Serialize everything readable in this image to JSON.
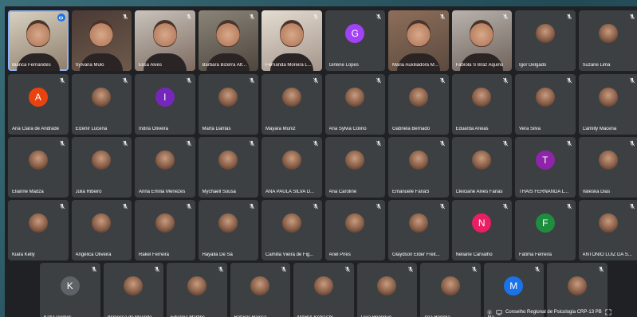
{
  "colors": {
    "stage": "#202124",
    "tile": "#3c4043",
    "speaking": "#1a73e8",
    "highlight": "#8ab4f8"
  },
  "participants": {
    "row1": [
      {
        "name": "Bianca Fernandes",
        "kind": "video",
        "state": "speaking"
      },
      {
        "name": "Sylvana Mulo",
        "kind": "video",
        "state": "muted"
      },
      {
        "name": "Elisa Alves",
        "kind": "video",
        "state": "muted"
      },
      {
        "name": "Bárbara Bizerra Alt...",
        "kind": "video",
        "state": "muted"
      },
      {
        "name": "Fernanda Moreira L...",
        "kind": "video",
        "state": "muted"
      },
      {
        "name": "Girlene Lopes",
        "kind": "letter",
        "letter": "G",
        "color": "#a142f4",
        "state": "muted"
      },
      {
        "name": "Maria Auxiliadora M...",
        "kind": "video",
        "state": "muted"
      },
      {
        "name": "Fabíola S Braz Aquino",
        "kind": "video",
        "state": "muted"
      },
      {
        "name": "Igor Delgado",
        "kind": "photo",
        "state": "muted"
      },
      {
        "name": "Suzane Lima",
        "kind": "photo",
        "state": "muted"
      }
    ],
    "row2": [
      {
        "name": "Ana Clara de Andrade",
        "kind": "letter",
        "letter": "A",
        "color": "#e8430e",
        "state": "muted"
      },
      {
        "name": "Elzenir Lucena",
        "kind": "photo",
        "state": "muted"
      },
      {
        "name": "Indira Oliveira",
        "kind": "letter",
        "letter": "I",
        "color": "#7627bb",
        "state": "muted"
      },
      {
        "name": "Marta Dantas",
        "kind": "photo",
        "state": "muted"
      },
      {
        "name": "Mayara Muniz",
        "kind": "photo",
        "state": "muted"
      },
      {
        "name": "Ana Sylvia Colino",
        "kind": "photo",
        "state": "muted"
      },
      {
        "name": "Gabriela Bernado",
        "kind": "photo",
        "state": "muted"
      },
      {
        "name": "Eduarda Areias",
        "kind": "photo",
        "state": "muted"
      },
      {
        "name": "Vera Silva",
        "kind": "photo",
        "state": "muted"
      },
      {
        "name": "Camilly Macena",
        "kind": "photo",
        "state": "muted"
      }
    ],
    "row3": [
      {
        "name": "Elianne Madza",
        "kind": "photo",
        "state": "muted"
      },
      {
        "name": "Júlia Ribeiro",
        "kind": "photo",
        "state": "muted"
      },
      {
        "name": "Anna Emília Menezes",
        "kind": "photo",
        "state": "muted"
      },
      {
        "name": "Mychaell Sousa",
        "kind": "photo",
        "state": "muted"
      },
      {
        "name": "ANA PAULA SILVA D...",
        "kind": "photo",
        "state": "muted"
      },
      {
        "name": "Ana Caroline",
        "kind": "photo",
        "state": "muted"
      },
      {
        "name": "Emanuele FariaS",
        "kind": "photo",
        "state": "muted"
      },
      {
        "name": "Cleiciane Alves Farias",
        "kind": "photo",
        "state": "muted"
      },
      {
        "name": "THAIS FERNANDA L...",
        "kind": "letter",
        "letter": "T",
        "color": "#8e24aa",
        "state": "muted"
      },
      {
        "name": "Valeska Dias",
        "kind": "photo",
        "state": "muted"
      }
    ],
    "row4": [
      {
        "name": "Kiara Kelly",
        "kind": "photo",
        "state": "muted"
      },
      {
        "name": "Angélica Oliveira",
        "kind": "photo",
        "state": "muted"
      },
      {
        "name": "Rakel Ferreira",
        "kind": "photo",
        "state": "muted"
      },
      {
        "name": "Hayalla De Sá",
        "kind": "photo",
        "state": "muted"
      },
      {
        "name": "Camilla Vieira de Fig...",
        "kind": "photo",
        "state": "muted"
      },
      {
        "name": "Ariel Pires",
        "kind": "photo",
        "state": "muted"
      },
      {
        "name": "Glaydson Elder Freit...",
        "kind": "photo",
        "state": "muted"
      },
      {
        "name": "Neliane Carvalho",
        "kind": "letter",
        "letter": "N",
        "color": "#e91e63",
        "state": "muted"
      },
      {
        "name": "Fátima Ferreira",
        "kind": "letter",
        "letter": "F",
        "color": "#1e8e3e",
        "state": "muted"
      },
      {
        "name": "ANTONIO LUIZ DA S...",
        "kind": "photo",
        "state": "muted"
      }
    ],
    "row5": [
      {
        "name": "Katia Gomes",
        "kind": "letter",
        "letter": "K",
        "color": "#5f6368",
        "state": "muted"
      },
      {
        "name": "Wanessa de Macêdo",
        "kind": "photo",
        "state": "muted"
      },
      {
        "name": "Edvânia Martins",
        "kind": "photo",
        "state": "muted"
      },
      {
        "name": "Rafaela Raissa",
        "kind": "photo",
        "state": "muted"
      },
      {
        "name": "MARIA SANTOS",
        "kind": "photo",
        "state": "muted"
      },
      {
        "name": "Lívia Henrique",
        "kind": "photo",
        "state": "muted"
      },
      {
        "name": "Ana Rogélia",
        "kind": "photo",
        "state": "muted"
      },
      {
        "name": "Ma",
        "kind": "letter",
        "letter": "M",
        "color": "#1a73e8",
        "state": "muted"
      },
      {
        "name": "",
        "kind": "photo",
        "state": "muted"
      }
    ]
  },
  "bottombar": {
    "meeting_name": "Conselho Regional de Psicologia CRP-13 PB"
  }
}
